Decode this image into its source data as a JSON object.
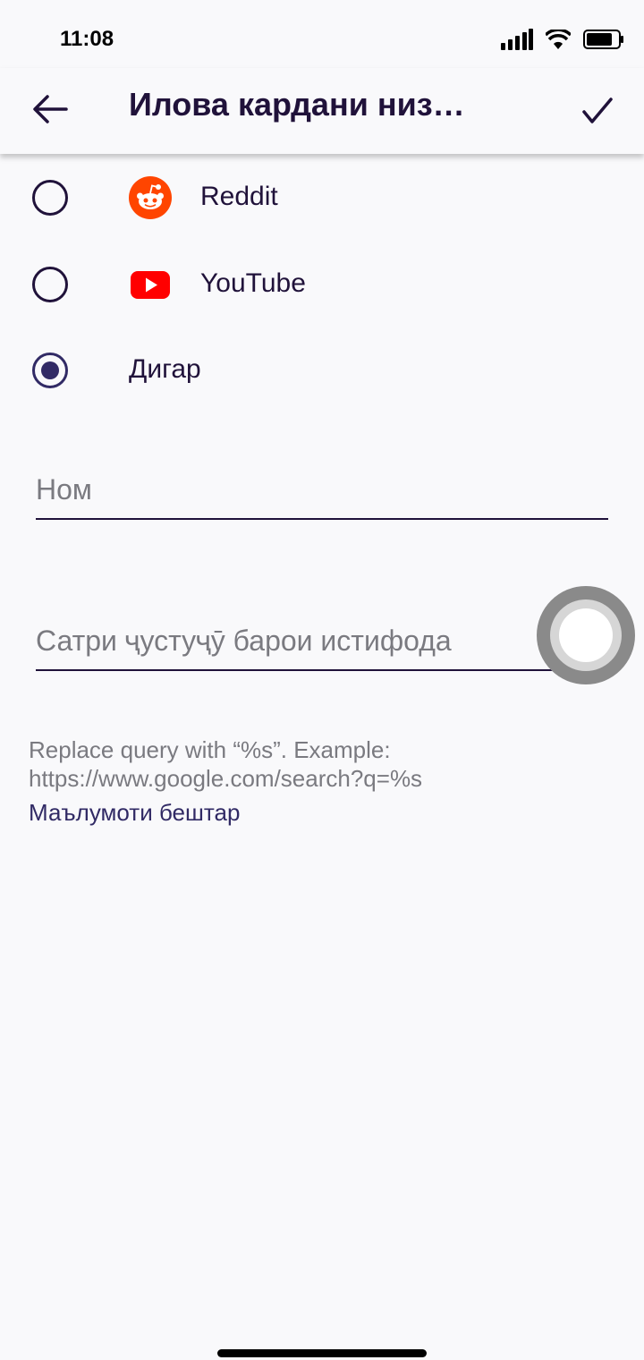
{
  "status_bar": {
    "time": "11:08",
    "icons": [
      "signal-icon",
      "wifi-icon",
      "battery-icon"
    ]
  },
  "toolbar": {
    "title": "Илова кардани низ…",
    "back_icon": "back-arrow-icon",
    "confirm_icon": "checkmark-icon"
  },
  "engines": [
    {
      "label": "Reddit",
      "icon": "reddit-icon",
      "selected": false
    },
    {
      "label": "YouTube",
      "icon": "youtube-icon",
      "selected": false
    },
    {
      "label": "Дигар",
      "icon": "",
      "selected": true
    }
  ],
  "form": {
    "name_placeholder": "Ном",
    "query_placeholder": "Сатри ҷустуҷӯ барои истифода"
  },
  "hint": {
    "text": "Replace query with “%s”. Example: https://www.google.com/search?q=%s",
    "learn_more": "Маълумоти бештар"
  },
  "colors": {
    "background": "#f9f9fb",
    "primary_text": "#20123a",
    "accent": "#312a65",
    "reddit": "#ff4500",
    "youtube": "#ff0000"
  }
}
